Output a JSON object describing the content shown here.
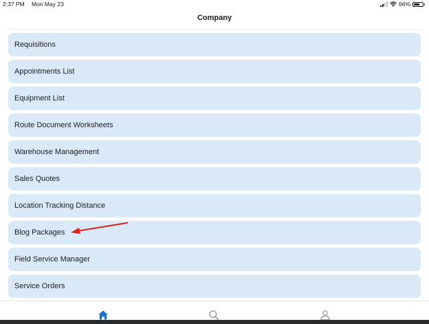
{
  "status_bar": {
    "time": "2:37 PM",
    "date": "Mon May 23",
    "battery": "66%",
    "battery_level": 0.66
  },
  "header": {
    "title": "Company"
  },
  "menu": {
    "items": [
      {
        "label": "Requisitions"
      },
      {
        "label": "Appointments List"
      },
      {
        "label": "Equipment List"
      },
      {
        "label": "Route Document Worksheets"
      },
      {
        "label": "Warehouse Management"
      },
      {
        "label": "Sales Quotes"
      },
      {
        "label": "Location Tracking Distance"
      },
      {
        "label": "Blog Packages"
      },
      {
        "label": "Field Service Manager"
      },
      {
        "label": "Service Orders"
      }
    ]
  },
  "annotation": {
    "color": "#e0201b",
    "target": "Blog Packages"
  },
  "tab_bar": {
    "active_color": "#1f6fd1",
    "inactive_color": "#8e8e93",
    "tabs": [
      {
        "icon": "home-icon",
        "active": true
      },
      {
        "icon": "search-icon",
        "active": false
      },
      {
        "icon": "profile-icon",
        "active": false
      }
    ]
  }
}
